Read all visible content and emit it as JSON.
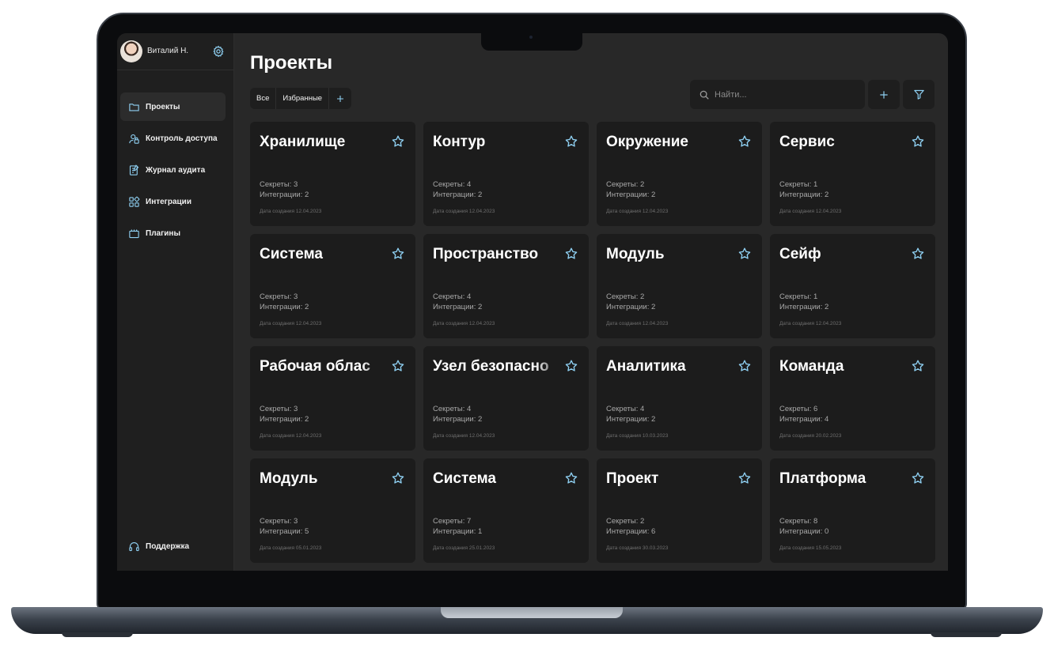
{
  "user": {
    "name": "Виталий Н."
  },
  "sidebar": {
    "items": [
      {
        "label": "Проекты",
        "icon": "folder-icon",
        "active": true
      },
      {
        "label": "Контроль доступа",
        "icon": "access-control-icon",
        "active": false
      },
      {
        "label": "Журнал аудита",
        "icon": "audit-log-icon",
        "active": false
      },
      {
        "label": "Интеграции",
        "icon": "integrations-icon",
        "active": false
      },
      {
        "label": "Плагины",
        "icon": "plugins-icon",
        "active": false
      }
    ],
    "support_label": "Поддержка"
  },
  "main": {
    "title": "Проекты",
    "tabs": [
      {
        "label": "Все"
      },
      {
        "label": "Избранные"
      }
    ],
    "search": {
      "placeholder": "Найти..."
    }
  },
  "projects": [
    {
      "name": "Хранилище",
      "secrets": "Секреты: 3",
      "integrations": "Интеграции: 2",
      "created": "Дата создания 12.04.2023"
    },
    {
      "name": "Контур",
      "secrets": "Секреты: 4",
      "integrations": "Интеграции: 2",
      "created": "Дата создания 12.04.2023"
    },
    {
      "name": "Окружение",
      "secrets": "Секреты: 2",
      "integrations": "Интеграции: 2",
      "created": "Дата создания 12.04.2023"
    },
    {
      "name": "Сервис",
      "secrets": "Секреты: 1",
      "integrations": "Интеграции: 2",
      "created": "Дата создания 12.04.2023"
    },
    {
      "name": "Система",
      "secrets": "Секреты: 3",
      "integrations": "Интеграции: 2",
      "created": "Дата создания 12.04.2023"
    },
    {
      "name": "Пространство",
      "secrets": "Секреты: 4",
      "integrations": "Интеграции: 2",
      "created": "Дата создания 12.04.2023"
    },
    {
      "name": "Модуль",
      "secrets": "Секреты: 2",
      "integrations": "Интеграции: 2",
      "created": "Дата создания 12.04.2023"
    },
    {
      "name": "Сейф",
      "secrets": "Секреты: 1",
      "integrations": "Интеграции: 2",
      "created": "Дата создания 12.04.2023"
    },
    {
      "name": "Рабочая облас",
      "secrets": "Секреты: 3",
      "integrations": "Интеграции: 2",
      "created": "Дата создания 12.04.2023"
    },
    {
      "name": "Узел безопасно",
      "secrets": "Секреты: 4",
      "integrations": "Интеграции: 2",
      "created": "Дата создания 12.04.2023"
    },
    {
      "name": "Аналитика",
      "secrets": "Секреты: 4",
      "integrations": "Интеграции: 2",
      "created": "Дата создания 10.03.2023"
    },
    {
      "name": "Команда",
      "secrets": "Секреты: 6",
      "integrations": "Интеграции: 4",
      "created": "Дата создания 20.02.2023"
    },
    {
      "name": "Модуль",
      "secrets": "Секреты: 3",
      "integrations": "Интеграции: 5",
      "created": "Дата создания 05.01.2023"
    },
    {
      "name": "Система",
      "secrets": "Секреты: 7",
      "integrations": "Интеграции: 1",
      "created": "Дата создания 25.01.2023"
    },
    {
      "name": "Проект",
      "secrets": "Секреты: 2",
      "integrations": "Интеграции: 6",
      "created": "Дата создания 30.03.2023"
    },
    {
      "name": "Платформа",
      "secrets": "Секреты: 8",
      "integrations": "Интеграции: 0",
      "created": "Дата создания 15.05.2023"
    }
  ],
  "colors": {
    "accent": "#8fd0f2",
    "background": "#282828",
    "card": "#1c1c1c",
    "sidebar": "#1f1f1f"
  }
}
